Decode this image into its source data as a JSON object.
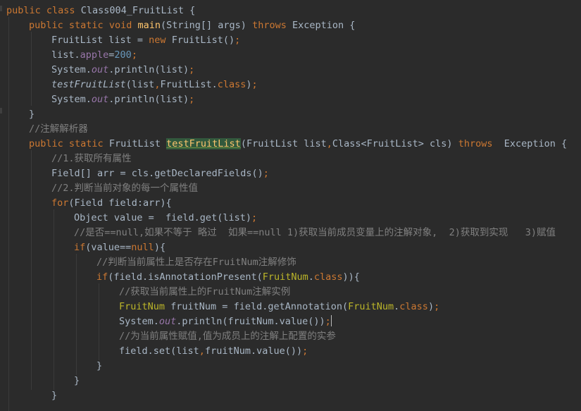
{
  "code": {
    "l1": [
      "public",
      "class",
      "Class004_FruitList {"
    ],
    "l2": [
      "public",
      "static",
      "void",
      "main",
      "(String[] args)",
      "throws",
      "Exception {"
    ],
    "l3": [
      "FruitList list = ",
      "new",
      "FruitList()",
      ";"
    ],
    "l4": [
      "list.",
      "apple",
      "=",
      "200",
      ";"
    ],
    "l5": [
      "System.",
      "out",
      ".println(list)",
      ";"
    ],
    "l6": [
      "testFruitList",
      "(list",
      ",",
      "FruitList.",
      "class",
      ")",
      ";"
    ],
    "l7": [
      "System.",
      "out",
      ".println(list)",
      ";"
    ],
    "l8": [
      "}"
    ],
    "l9": [
      "//注解解析器"
    ],
    "l10": [
      "public",
      "static",
      "FruitList",
      "testFruitList",
      "(FruitList list",
      ",",
      "Class<FruitList> cls)",
      "throws",
      "Exception {"
    ],
    "l11": [
      "//1.获取所有属性"
    ],
    "l12": [
      "Field[] arr = cls.getDeclaredFields()",
      ";"
    ],
    "l13": [
      "//2.判断当前对象的每一个属性值"
    ],
    "l14": [
      "for",
      "(Field field:arr){"
    ],
    "l15": [
      "Object value =  field.get(list)",
      ";"
    ],
    "l16": [
      "//是否==null,如果不等于 略过  如果==null 1)获取当前成员变量上的注解对象,  2)获取到实现   3)赋值"
    ],
    "l17": [
      "if",
      "(value==",
      "null",
      "){"
    ],
    "l18": [
      "//判断当前属性上是否存在FruitNum注解修饰"
    ],
    "l19": [
      "if",
      "(field.isAnnotationPresent(",
      "FruitNum",
      ".",
      "class",
      ")){"
    ],
    "l20": [
      "//获取当前属性上的FruitNum注解实例"
    ],
    "l21": [
      "FruitNum",
      " fruitNum = field.getAnnotation(",
      "FruitNum",
      ".",
      "class",
      ")",
      ";"
    ],
    "l22": [
      "System.",
      "out",
      ".println(fruitNum.value())",
      ";"
    ],
    "l23": [
      "//为当前属性赋值,值为成员上的注解上配置的实参"
    ],
    "l24": [
      "field.set(list",
      ",",
      "fruitNum.value())",
      ";"
    ],
    "l25": [
      "}"
    ],
    "l26": [
      "}"
    ],
    "l27": [
      "}"
    ]
  },
  "colors": {
    "background": "#2b2b2b",
    "keyword": "#cc7832",
    "method_declaration": "#ffc66d",
    "field": "#9876aa",
    "number": "#6897bb",
    "comment": "#808080",
    "annotation": "#bbb529",
    "default_text": "#a9b7c6"
  }
}
